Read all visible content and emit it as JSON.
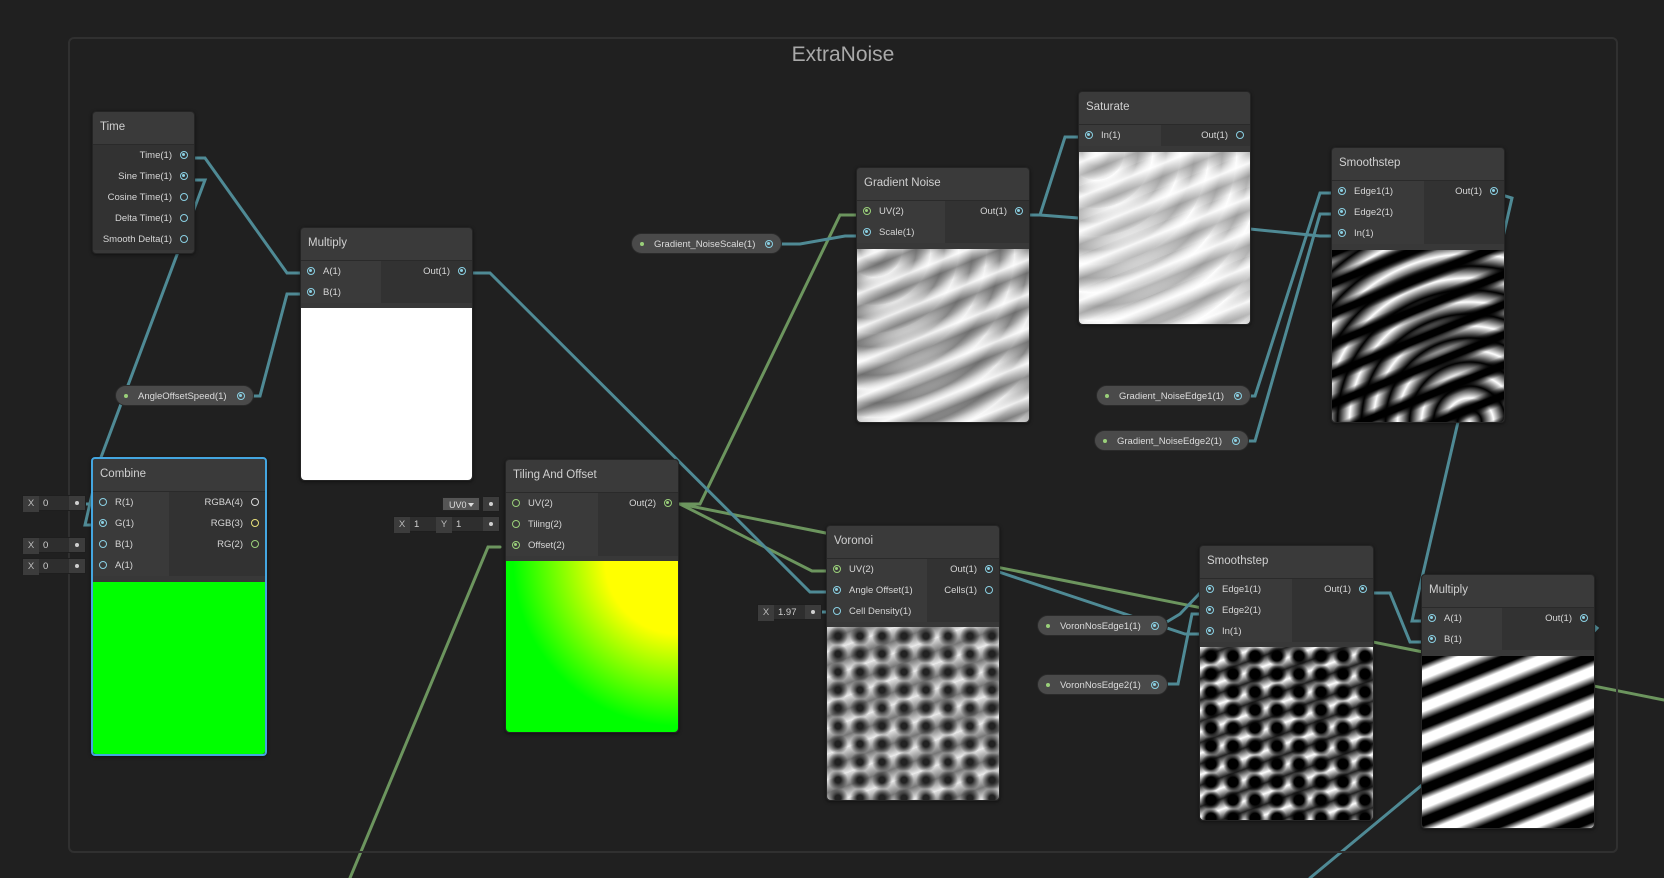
{
  "group": {
    "title": "ExtraNoise"
  },
  "colors": {
    "background": "#202020",
    "wire_float": "#4f8a95",
    "wire_vector": "#6c955e",
    "selection": "#44a6e0"
  },
  "nodes": {
    "time": {
      "title": "Time",
      "outputs": [
        "Time(1)",
        "Sine Time(1)",
        "Cosine Time(1)",
        "Delta Time(1)",
        "Smooth Delta(1)"
      ]
    },
    "multiply1": {
      "title": "Multiply",
      "inputs": [
        "A(1)",
        "B(1)"
      ],
      "outputs": [
        "Out(1)"
      ]
    },
    "combine": {
      "title": "Combine",
      "inputs": [
        "R(1)",
        "G(1)",
        "B(1)",
        "A(1)"
      ],
      "outputs": [
        "RGBA(4)",
        "RGB(3)",
        "RG(2)"
      ]
    },
    "tiling": {
      "title": "Tiling And Offset",
      "inputs": [
        "UV(2)",
        "Tiling(2)",
        "Offset(2)"
      ],
      "outputs": [
        "Out(2)"
      ]
    },
    "gradient_noise": {
      "title": "Gradient Noise",
      "inputs": [
        "UV(2)",
        "Scale(1)"
      ],
      "outputs": [
        "Out(1)"
      ]
    },
    "saturate": {
      "title": "Saturate",
      "inputs": [
        "In(1)"
      ],
      "outputs": [
        "Out(1)"
      ]
    },
    "smoothstep1": {
      "title": "Smoothstep",
      "inputs": [
        "Edge1(1)",
        "Edge2(1)",
        "In(1)"
      ],
      "outputs": [
        "Out(1)"
      ]
    },
    "voronoi": {
      "title": "Voronoi",
      "inputs": [
        "UV(2)",
        "Angle Offset(1)",
        "Cell Density(1)"
      ],
      "outputs": [
        "Out(1)",
        "Cells(1)"
      ]
    },
    "smoothstep2": {
      "title": "Smoothstep",
      "inputs": [
        "Edge1(1)",
        "Edge2(1)",
        "In(1)"
      ],
      "outputs": [
        "Out(1)"
      ]
    },
    "multiply2": {
      "title": "Multiply",
      "inputs": [
        "A(1)",
        "B(1)"
      ],
      "outputs": [
        "Out(1)"
      ]
    }
  },
  "properties": {
    "angle_offset_speed": "AngleOffsetSpeed(1)",
    "gradient_noise_scale": "Gradient_NoiseScale(1)",
    "gradient_noise_edge1": "Gradient_NoiseEdge1(1)",
    "gradient_noise_edge2": "Gradient_NoiseEdge2(1)",
    "voronoi_edge1": "VoronNosEdge1(1)",
    "voronoi_edge2": "VoronNosEdge2(1)"
  },
  "fields": {
    "combine_r": {
      "label": "X",
      "value": "0"
    },
    "combine_b": {
      "label": "X",
      "value": "0"
    },
    "combine_a": {
      "label": "X",
      "value": "0"
    },
    "tiling_uv": "UV0",
    "tiling_x": {
      "label": "X",
      "value": "1"
    },
    "tiling_y": {
      "label": "Y",
      "value": "1"
    },
    "cell_density": {
      "label": "X",
      "value": "1.97"
    }
  }
}
